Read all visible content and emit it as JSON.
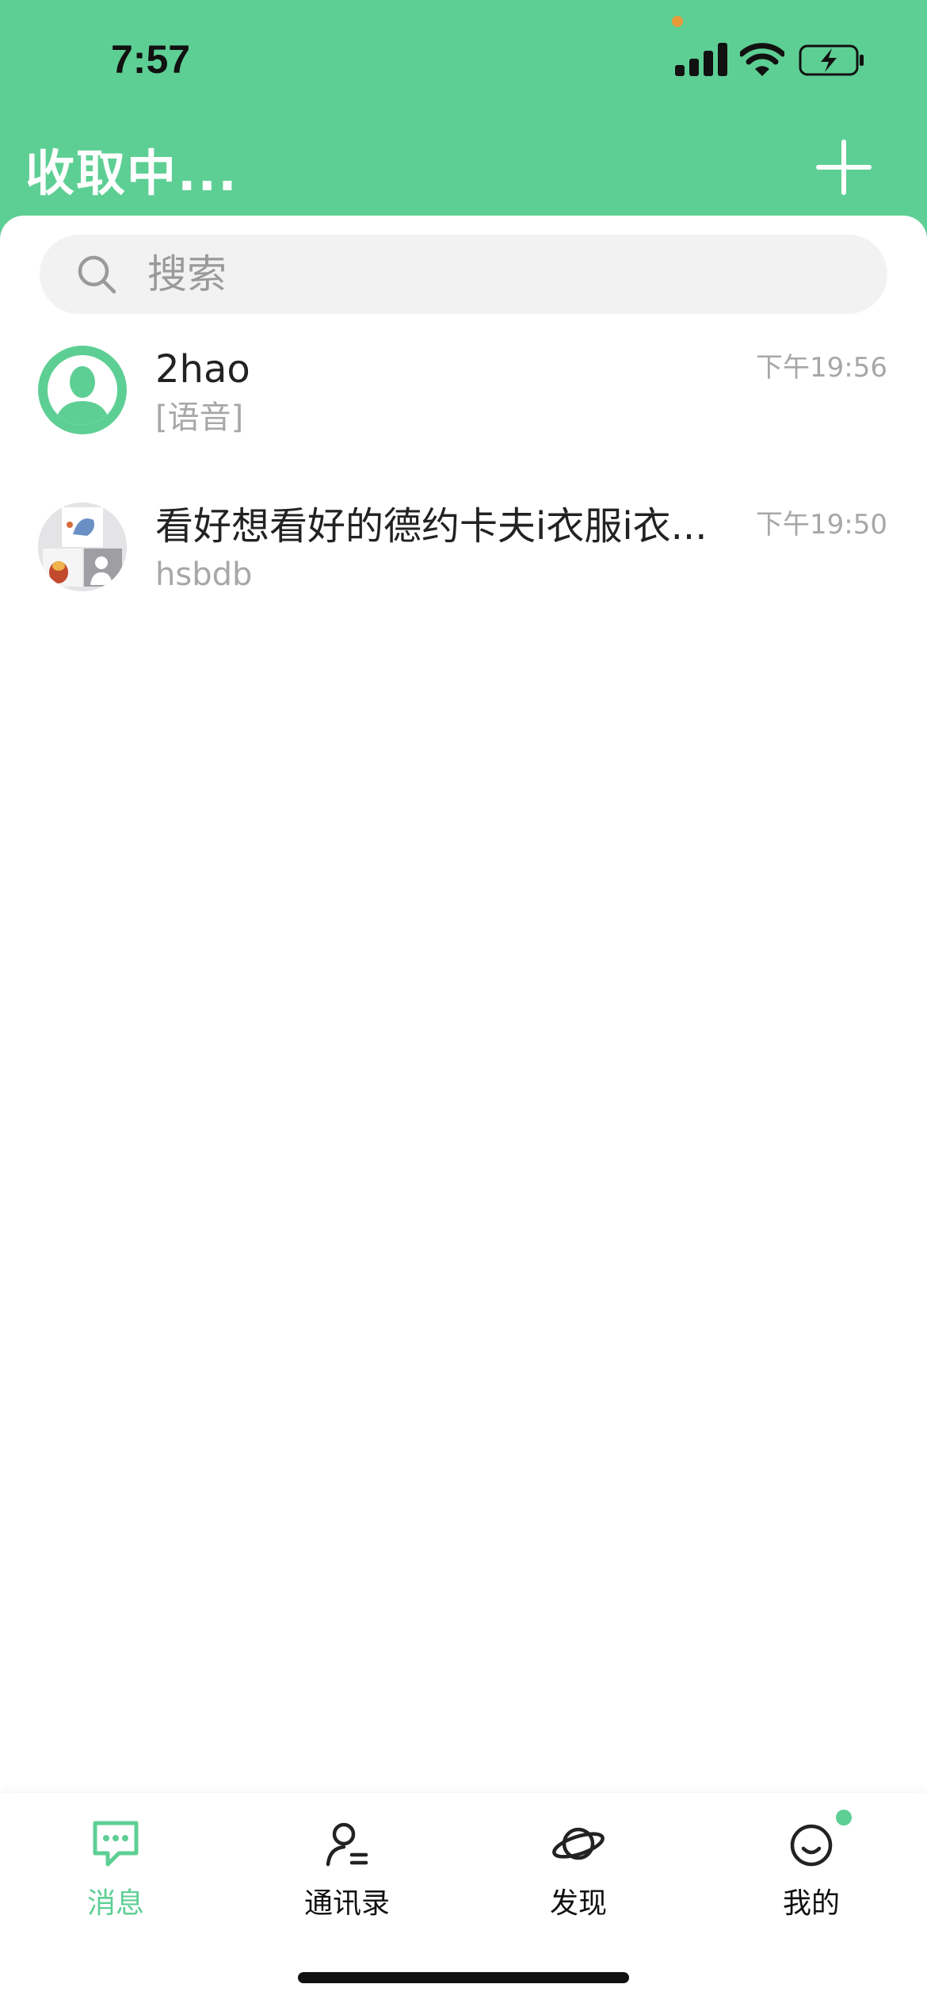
{
  "status_bar": {
    "time": "7:57"
  },
  "header": {
    "title": "收取中...",
    "add_icon": "plus-icon"
  },
  "search": {
    "placeholder": "搜索",
    "icon": "search-icon"
  },
  "chats": [
    {
      "name": "2hao",
      "preview": "[语音]",
      "time": "下午19:56",
      "avatar": "default-person-avatar"
    },
    {
      "name": "看好想看好的德约卡夫i衣服i衣...",
      "preview": "hsbdb",
      "time": "下午19:50",
      "avatar": "group-avatar-grid"
    }
  ],
  "tabs": [
    {
      "label": "消息",
      "icon": "message-icon",
      "active": true
    },
    {
      "label": "通讯录",
      "icon": "contacts-icon",
      "active": false
    },
    {
      "label": "发现",
      "icon": "planet-icon",
      "active": false
    },
    {
      "label": "我的",
      "icon": "smile-icon",
      "active": false
    }
  ],
  "colors": {
    "accent": "#5ecf94",
    "text": "#222222",
    "muted": "#a7a7a7",
    "search_bg": "#f2f2f2"
  }
}
